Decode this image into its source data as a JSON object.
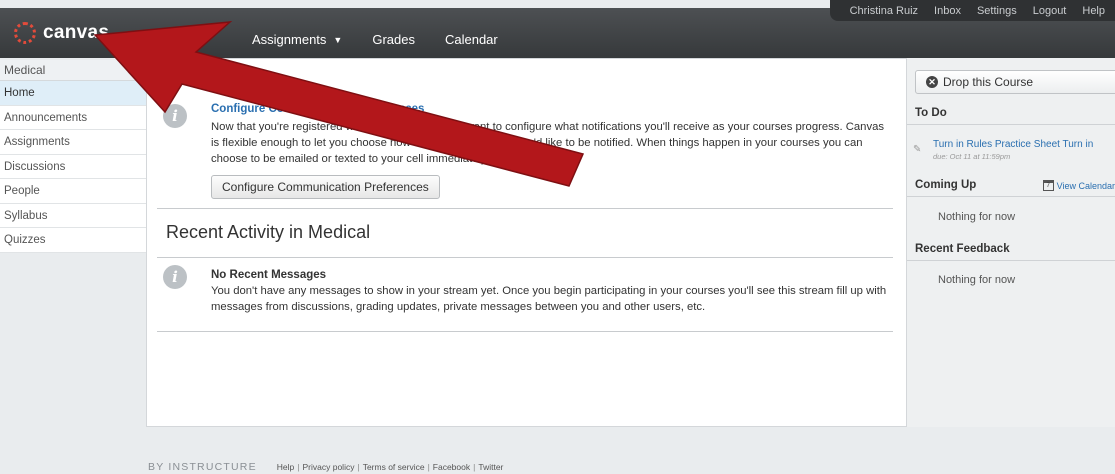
{
  "header": {
    "logo_text": "canvas",
    "nav": [
      {
        "label": "Assignments",
        "has_caret": true
      },
      {
        "label": "Grades"
      },
      {
        "label": "Calendar"
      }
    ],
    "user_menu": [
      "Christina Ruiz",
      "Inbox",
      "Settings",
      "Logout",
      "Help"
    ]
  },
  "leftnav": {
    "course_title": "Medical",
    "items": [
      "Home",
      "Announcements",
      "Assignments",
      "Discussions",
      "People",
      "Syllabus",
      "Quizzes"
    ],
    "active_index": 0
  },
  "main": {
    "config_message": {
      "title": "Configure Communication Preferences",
      "body": "Now that you're registered with Canvas, you might want to configure what notifications you'll receive as your courses progress. Canvas is flexible enough to let you choose how and for what events you'd like to be notified. When things happen in your courses you can choose to be emailed or texted to your cell immediately, daily or weekly.",
      "button_label": "Configure Communication Preferences"
    },
    "recent_activity_title": "Recent Activity in Medical",
    "stream_message": {
      "title": "No Recent Messages",
      "body": "You don't have any messages to show in your stream yet. Once you begin participating in your courses you'll see this stream fill up with messages from discussions, grading updates, private messages between you and other users, etc."
    }
  },
  "sidebar": {
    "drop_button": "Drop this Course",
    "todo_heading": "To Do",
    "todo_item": "Turn in Rules Practice Sheet Turn in",
    "todo_due": "due: Oct 11 at 11:59pm",
    "coming_up_heading": "Coming Up",
    "view_calendar": "View Calendar",
    "coming_up_empty": "Nothing for now",
    "feedback_heading": "Recent Feedback",
    "feedback_empty": "Nothing for now"
  },
  "footer": {
    "brand": "BY INSTRUCTURE",
    "links": [
      "Help",
      "Privacy policy",
      "Terms of service",
      "Facebook",
      "Twitter"
    ]
  },
  "colors": {
    "accent_link": "#2a6fb0",
    "annotation_arrow": "#b3171b",
    "logo": "#e24b3b"
  }
}
